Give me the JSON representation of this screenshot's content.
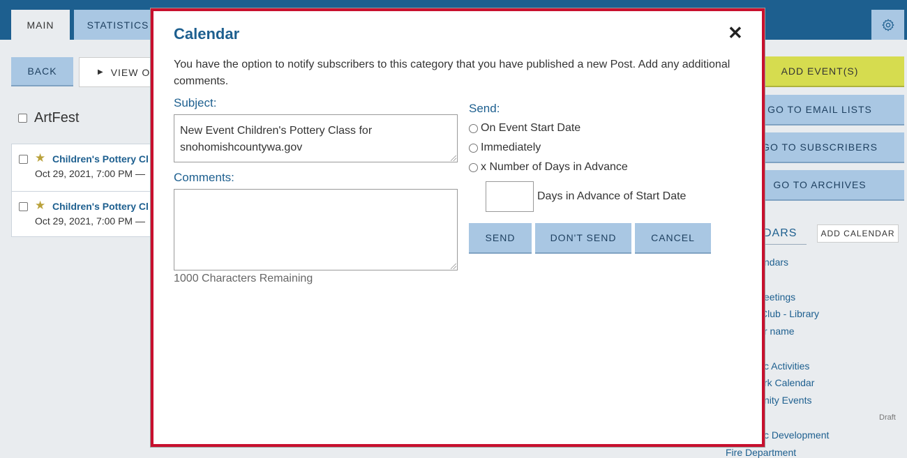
{
  "tabs": {
    "main": "MAIN",
    "statistics": "STATISTICS"
  },
  "toolbar": {
    "back": "BACK",
    "view": "VIEW O"
  },
  "category": {
    "title": "ArtFest"
  },
  "events": [
    {
      "title": "Children's Pottery Cl",
      "date": "Oct 29, 2021, 7:00 PM —"
    },
    {
      "title": "Children's Pottery Cl",
      "date": "Oct 29, 2021, 7:00 PM —"
    }
  ],
  "sidebar": {
    "add_events": "ADD EVENT(S)",
    "email_lists": "GO TO EMAIL LISTS",
    "subscribers": "GO TO SUBSCRIBERS",
    "archives": "GO TO ARCHIVES",
    "calendars_heading": "DARS",
    "add_calendar": "ADD CALENDAR",
    "draft": "Draft",
    "calendar_links": [
      "ndars",
      "eetings",
      "Club - Library",
      "r name",
      "c Activities",
      "rk Calendar",
      "nity Events",
      "c Development",
      "Fire Department"
    ]
  },
  "modal": {
    "title": "Calendar",
    "close": "✕",
    "description": "You have the option to notify subscribers to this category that you have published a new Post. Add any additional comments.",
    "subject_label": "Subject:",
    "subject_value": "New Event Children's Pottery Class for snohomishcountywa.gov",
    "comments_label": "Comments:",
    "comments_value": "",
    "chars_remaining": "1000 Characters Remaining",
    "send_label": "Send:",
    "options": [
      "On Event Start Date",
      "Immediately",
      "x Number of Days in Advance"
    ],
    "days_value": "",
    "days_label": "Days in Advance of Start Date",
    "buttons": {
      "send": "SEND",
      "dont_send": "DON'T SEND",
      "cancel": "CANCEL"
    }
  },
  "colors": {
    "primary": "#1d5f8f",
    "accent_button": "#a9c7e3",
    "add_events": "#d6dc4f",
    "modal_border": "#c8102e"
  }
}
